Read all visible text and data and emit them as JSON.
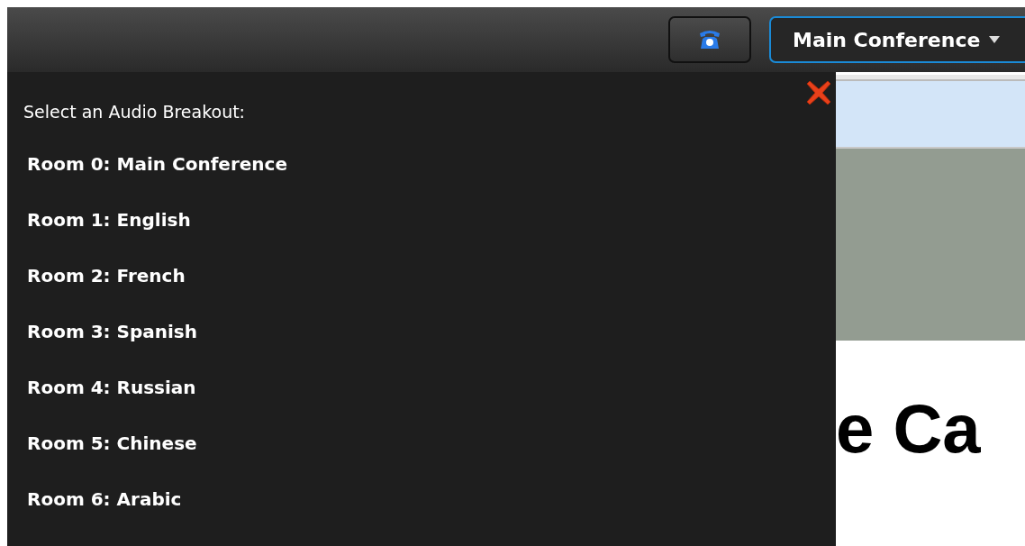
{
  "toolbar": {
    "conference_dropdown": {
      "label": "Main Conference"
    }
  },
  "breakout_menu": {
    "title": "Select an Audio Breakout:",
    "rooms": [
      {
        "label": "Room 0: Main Conference"
      },
      {
        "label": "Room 1: English"
      },
      {
        "label": "Room 2: French"
      },
      {
        "label": "Room 3: Spanish"
      },
      {
        "label": "Room 4: Russian"
      },
      {
        "label": "Room 5: Chinese"
      },
      {
        "label": "Room 6: Arabic"
      }
    ]
  },
  "slide": {
    "heading": "e Ca"
  }
}
